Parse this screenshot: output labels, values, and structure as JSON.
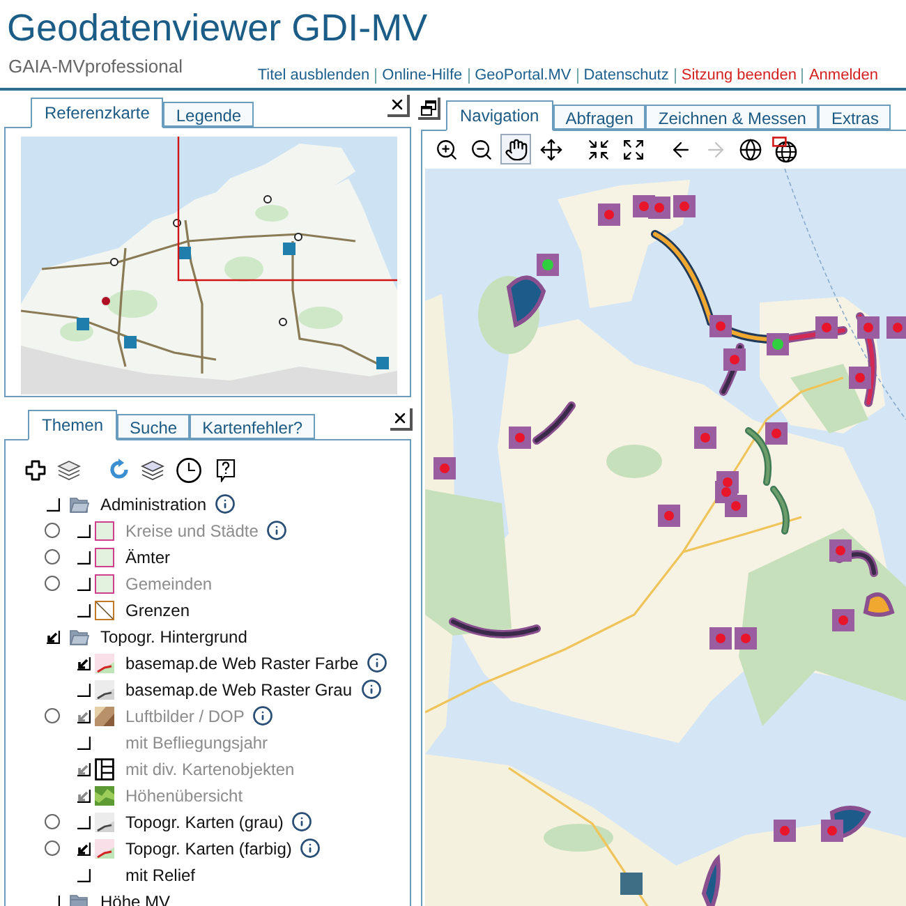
{
  "header": {
    "title": "Geodatenviewer GDI-MV",
    "subtitle": "GAIA-MVprofessional",
    "links": [
      {
        "label": "Titel ausblenden",
        "color": "#1d5f8c"
      },
      {
        "label": "Online-Hilfe",
        "color": "#1d5f8c"
      },
      {
        "label": "GeoPortal.MV",
        "color": "#1d5f8c"
      },
      {
        "label": "Datenschutz",
        "color": "#1d5f8c"
      },
      {
        "label": "Sitzung beenden",
        "color": "#d41f1f"
      },
      {
        "label": "Anmelden",
        "color": "#d41f1f"
      }
    ]
  },
  "reference_panel": {
    "tabs": [
      {
        "label": "Referenzkarte",
        "selected": true
      },
      {
        "label": "Legende",
        "selected": false
      }
    ]
  },
  "layer_panel": {
    "tabs": [
      {
        "label": "Themen",
        "selected": true
      },
      {
        "label": "Suche",
        "selected": false
      },
      {
        "label": "Kartenfehler?",
        "selected": false
      }
    ],
    "tree": [
      {
        "label": "Administration",
        "kind": "folder",
        "checked": false,
        "expanded": true,
        "info": true,
        "children": [
          {
            "label": "Kreise und Städte",
            "kind": "area",
            "selected": false,
            "checked": false,
            "disabled": true,
            "info": true
          },
          {
            "label": "Ämter",
            "kind": "area",
            "selected": false,
            "checked": false,
            "disabled": false,
            "info": false
          },
          {
            "label": "Gemeinden",
            "kind": "area",
            "selected": false,
            "checked": false,
            "disabled": true,
            "info": false
          },
          {
            "label": "Grenzen",
            "kind": "line",
            "checked": false,
            "disabled": false,
            "info": false
          }
        ]
      },
      {
        "label": "Topogr. Hintergrund",
        "kind": "folder",
        "checked": true,
        "expanded": true,
        "info": false,
        "children": [
          {
            "label": "basemap.de Web Raster Farbe",
            "kind": "map-color",
            "checked": true,
            "disabled": false,
            "info": true
          },
          {
            "label": "basemap.de Web Raster Grau",
            "kind": "map-grey",
            "checked": false,
            "disabled": false,
            "info": true
          },
          {
            "label": "Luftbilder / DOP",
            "kind": "photo",
            "selected": false,
            "checked": true,
            "disabled": true,
            "info": true
          },
          {
            "label": "mit Befliegungsjahr",
            "kind": "plain",
            "checked": false,
            "disabled": true,
            "info": false
          },
          {
            "label": "mit div. Kartenobjekten",
            "kind": "table",
            "checked": true,
            "disabled": true,
            "info": false
          },
          {
            "label": "Höhenübersicht",
            "kind": "relief",
            "checked": true,
            "disabled": true,
            "info": false
          },
          {
            "label": "Topogr. Karten (grau)",
            "kind": "map-grey",
            "selected": false,
            "checked": false,
            "disabled": false,
            "info": true
          },
          {
            "label": "Topogr. Karten (farbig)",
            "kind": "map-color",
            "selected": false,
            "checked": true,
            "disabled": false,
            "info": true
          },
          {
            "label": "mit Relief",
            "kind": "plain",
            "checked": false,
            "disabled": false,
            "info": false
          }
        ]
      },
      {
        "label": "Höhe MV",
        "kind": "folder",
        "checked": false,
        "expanded": false,
        "info": false
      }
    ]
  },
  "map_panel": {
    "tabs": [
      {
        "label": "Navigation",
        "selected": true
      },
      {
        "label": "Abfragen",
        "selected": false
      },
      {
        "label": "Zeichnen & Messen",
        "selected": false
      },
      {
        "label": "Extras",
        "selected": false
      }
    ],
    "tools": [
      {
        "kind": "zoom-in",
        "selected": false,
        "disabled": false
      },
      {
        "kind": "zoom-out",
        "selected": false,
        "disabled": false
      },
      {
        "kind": "pan",
        "selected": true,
        "disabled": false
      },
      {
        "kind": "move",
        "selected": false,
        "disabled": false
      },
      {
        "kind": "shrink",
        "selected": false,
        "disabled": false
      },
      {
        "kind": "expand",
        "selected": false,
        "disabled": false
      },
      {
        "kind": "back",
        "selected": false,
        "disabled": false
      },
      {
        "kind": "forward",
        "selected": false,
        "disabled": true
      },
      {
        "kind": "globe",
        "selected": false,
        "disabled": false
      },
      {
        "kind": "globe-extent",
        "selected": false,
        "disabled": false
      }
    ]
  }
}
